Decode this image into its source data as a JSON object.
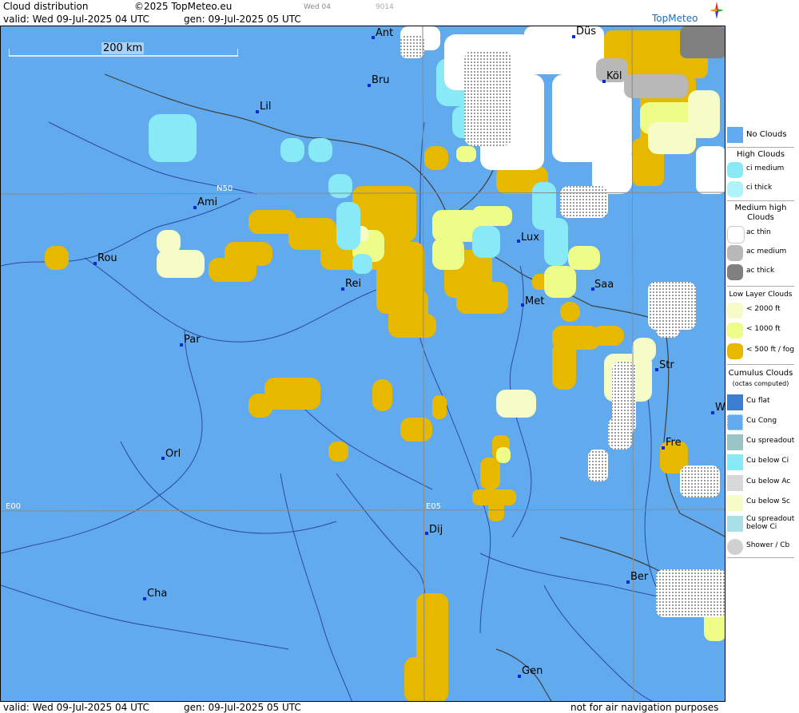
{
  "header": {
    "title": "Cloud distribution",
    "copyright": "©2025 TopMeteo.eu",
    "small_day": "Wed 04",
    "small_code": "9014",
    "valid": "valid:  Wed  09-Jul-2025  04 UTC",
    "gen": "gen: 09-Jul-2025 05 UTC"
  },
  "logo": "TopMeteo",
  "scale": {
    "label": "200 km"
  },
  "grid_labels": {
    "n50": "N50",
    "e00": "E00",
    "e05": "E05"
  },
  "cities": [
    {
      "name": "Ant"
    },
    {
      "name": "Düs"
    },
    {
      "name": "Köl"
    },
    {
      "name": "Bru"
    },
    {
      "name": "Lil"
    },
    {
      "name": "Ami"
    },
    {
      "name": "Rou"
    },
    {
      "name": "Lux"
    },
    {
      "name": "Rei"
    },
    {
      "name": "Saa"
    },
    {
      "name": "Met"
    },
    {
      "name": "Par"
    },
    {
      "name": "Str"
    },
    {
      "name": "W"
    },
    {
      "name": "Fre"
    },
    {
      "name": "Orl"
    },
    {
      "name": "Dij"
    },
    {
      "name": "Ber"
    },
    {
      "name": "Cha"
    },
    {
      "name": "Gen"
    }
  ],
  "legend": {
    "no_clouds": "No Clouds",
    "high_head": "High Clouds",
    "ci_medium": "ci medium",
    "ci_thick": "ci thick",
    "medium_head": "Medium high Clouds",
    "ac_thin": "ac thin",
    "ac_medium": "ac medium",
    "ac_thick": "ac thick",
    "low_head": "Low Layer Clouds",
    "low_2000": "< 2000 ft",
    "low_1000": "< 1000 ft",
    "low_500": "< 500 ft / fog",
    "cu_head": "Cumulus Clouds",
    "cu_sub": "(octas computed)",
    "cu_flat": "Cu flat",
    "cu_cong": "Cu Cong",
    "cu_spread": "Cu spreadout",
    "cu_below_ci": "Cu below Ci",
    "cu_below_ac": "Cu below Ac",
    "cu_below_sc": "Cu below Sc",
    "cu_spread_ci": "Cu spreadout below Ci",
    "shower": "Shower / Cb"
  },
  "footer": {
    "valid": "valid:  Wed  09-Jul-2025  04 UTC",
    "gen": "gen: 09-Jul-2025 05 UTC",
    "notice": "not for air navigation purposes"
  },
  "colors": {
    "no_clouds": "#62aaee",
    "ci_medium": "#88eaf6",
    "ci_thick": "#aef4fa",
    "ac_thin": "#ffffff",
    "ac_medium": "#b8b8b8",
    "ac_thick": "#808080",
    "low_2000": "#f6fcc8",
    "low_1000": "#eefc88",
    "low_500": "#e6b800"
  }
}
